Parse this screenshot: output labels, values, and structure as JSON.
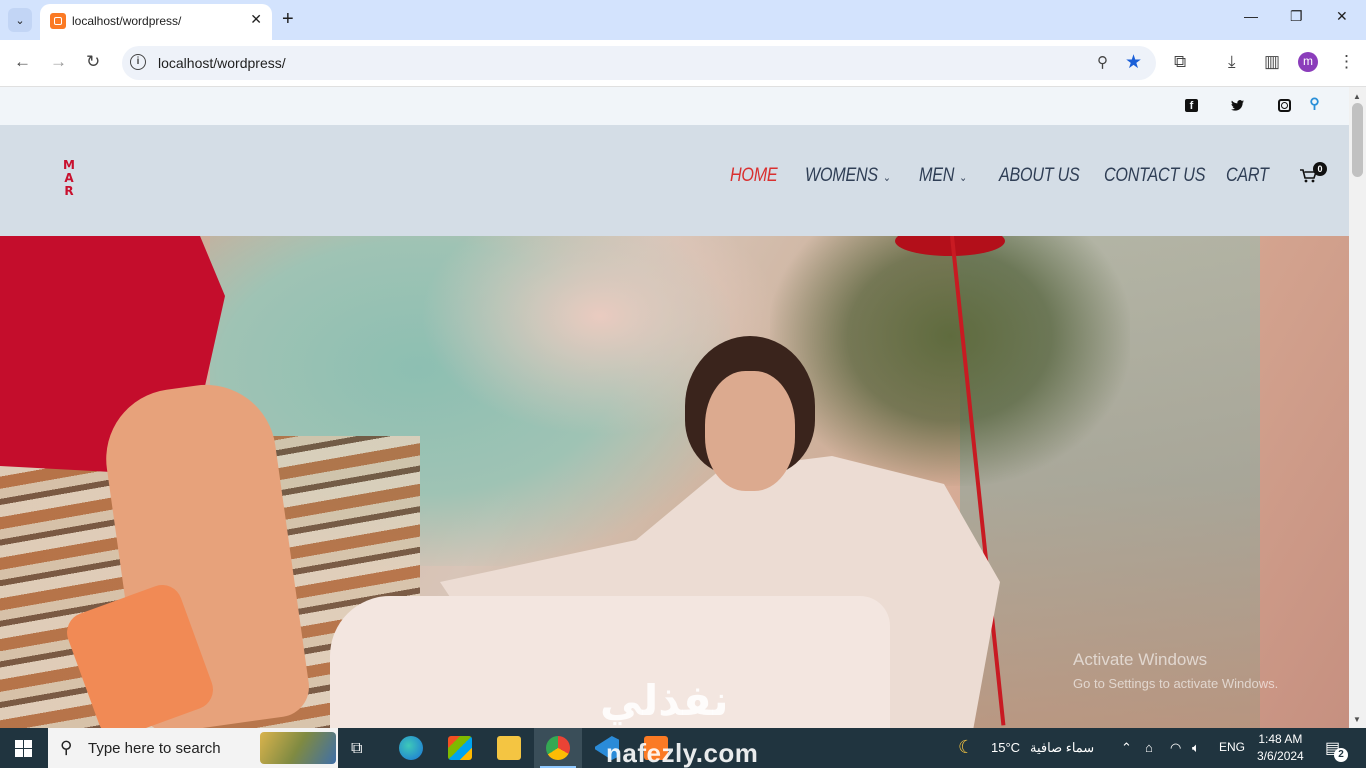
{
  "browser": {
    "tab": {
      "title": "localhost/wordpress/"
    },
    "new_tab_symbol": "+",
    "address": "localhost/wordpress/",
    "profile_initial": "m",
    "window_controls": {
      "minimize": "—",
      "maximize": "❐",
      "close": "✕"
    }
  },
  "site": {
    "topbar": {
      "social": [
        "facebook",
        "twitter",
        "instagram",
        "search"
      ]
    },
    "logo": {
      "letters": [
        "M",
        "A",
        "R"
      ],
      "color": "#c8102e"
    },
    "nav": {
      "items": [
        {
          "label": "HOME",
          "active": true
        },
        {
          "label": "WOMENS",
          "dropdown": true
        },
        {
          "label": "MEN",
          "dropdown": true
        },
        {
          "label": "ABOUT US"
        },
        {
          "label": "CONTACT US"
        },
        {
          "label": "CART"
        }
      ],
      "cart_count": "0",
      "active_color": "#d92f2f"
    },
    "hero": {
      "overlay_title": "Activate Windows",
      "overlay_subtitle": "Go to Settings to activate Windows.",
      "watermark_ar": "نفذلي"
    }
  },
  "taskbar": {
    "search_placeholder": "Type here to search",
    "weather": {
      "temperature": "15°C",
      "condition": "سماء صافية"
    },
    "language": "ENG",
    "time": "1:48 AM",
    "date": "3/6/2024",
    "notification_count": "2",
    "watermark_en": "nafezly.com"
  }
}
